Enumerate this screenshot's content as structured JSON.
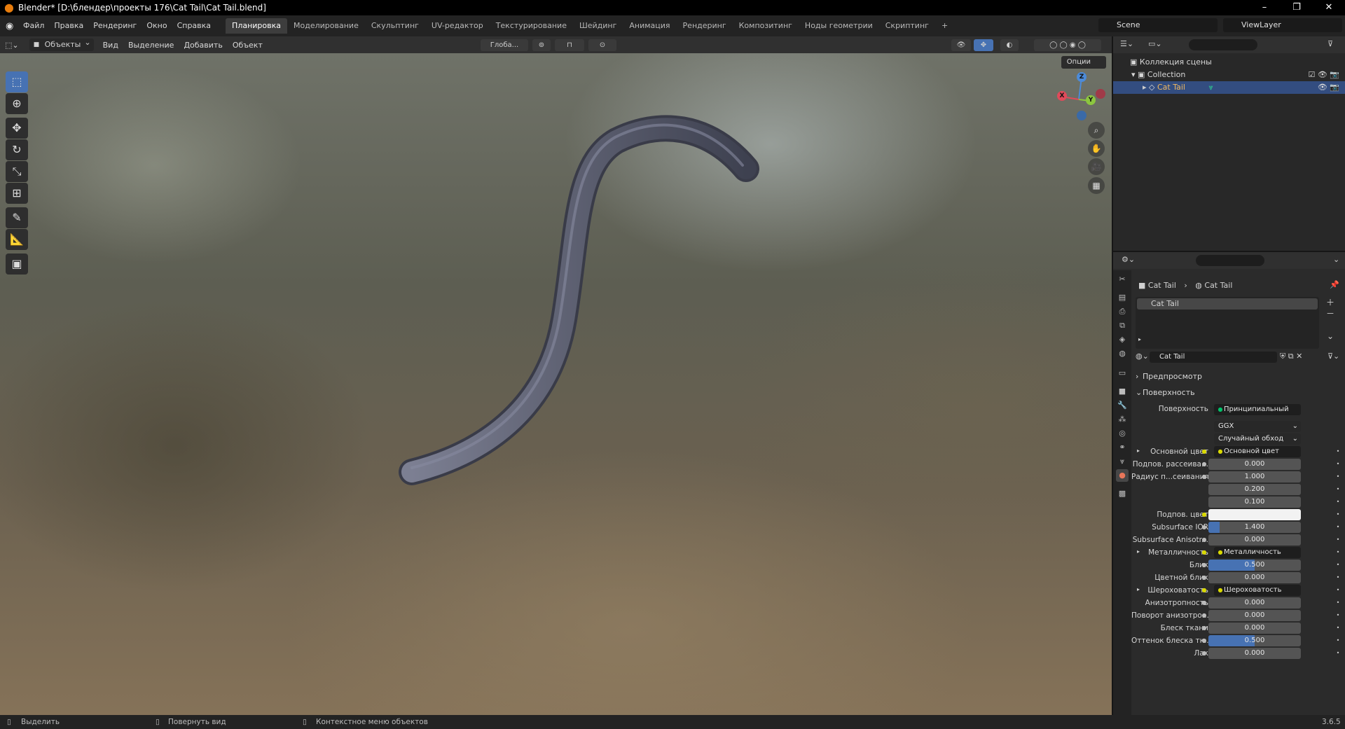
{
  "window": {
    "title": "Blender* [D:\\блендер\\проекты 176\\Cat Tail\\Cat Tail.blend]",
    "controls": [
      "–",
      "❐",
      "✕"
    ]
  },
  "menubar": {
    "items": [
      "Файл",
      "Правка",
      "Рендеринг",
      "Окно",
      "Справка"
    ],
    "workspaces": [
      "Планировка",
      "Моделирование",
      "Скульптинг",
      "UV-редактор",
      "Текстурирование",
      "Шейдинг",
      "Анимация",
      "Рендеринг",
      "Композитинг",
      "Ноды геометрии",
      "Скриптинг",
      "+"
    ],
    "active_workspace": "Планировка",
    "scene": "Scene",
    "view_layer": "ViewLayer"
  },
  "viewport_header": {
    "mode": "Объекты",
    "menus": [
      "Вид",
      "Выделение",
      "Добавить",
      "Объект"
    ],
    "transform_orientation": "Глоба...",
    "options": "Опции"
  },
  "toolbar": {
    "tools": [
      "select-box",
      "cursor",
      "move",
      "rotate",
      "scale",
      "transform",
      "annotate",
      "measure",
      "add-cube"
    ],
    "active": "select-box"
  },
  "gizmo": {
    "x": "X",
    "y": "Y",
    "z": "Z"
  },
  "outliner": {
    "scene_collection": "Коллекция сцены",
    "collection": "Collection",
    "object": "Cat Tail"
  },
  "properties": {
    "breadcrumb_object": "Cat Tail",
    "breadcrumb_material": "Cat Tail",
    "material_slot": "Cat Tail",
    "material_name": "Cat Tail",
    "panel_preview": "Предпросмотр",
    "panel_surface": "Поверхность",
    "surface_label": "Поверхность",
    "surface_value": "Принципиальный BSDF",
    "distribution": "GGX",
    "subsurface_method": "Случайный обход",
    "rows": [
      {
        "label": "Основной цвет",
        "value": "Основной цвет",
        "kind": "link",
        "arrow": true
      },
      {
        "label": "Подпов. рассеива...",
        "value": "0.000",
        "kind": "num",
        "fill": 0
      },
      {
        "label": "Радиус п...сеивания",
        "value": "1.000",
        "kind": "num",
        "fill": 0
      },
      {
        "label": "",
        "value": "0.200",
        "kind": "num",
        "fill": 0
      },
      {
        "label": "",
        "value": "0.100",
        "kind": "num",
        "fill": 0
      },
      {
        "label": "Подпов. цвет",
        "value": "",
        "kind": "color",
        "fill": 0
      },
      {
        "label": "Subsurface IOR",
        "value": "1.400",
        "kind": "num",
        "fill": 0.12
      },
      {
        "label": "Subsurface Anisotr...",
        "value": "0.000",
        "kind": "num",
        "fill": 0
      },
      {
        "label": "Металличность",
        "value": "Металличность",
        "kind": "link",
        "arrow": true
      },
      {
        "label": "Блик",
        "value": "0.500",
        "kind": "num",
        "fill": 0.5
      },
      {
        "label": "Цветной блик",
        "value": "0.000",
        "kind": "num",
        "fill": 0
      },
      {
        "label": "Шероховатость",
        "value": "Шероховатость",
        "kind": "link",
        "arrow": true
      },
      {
        "label": "Анизотропность",
        "value": "0.000",
        "kind": "num",
        "fill": 0
      },
      {
        "label": "Поворот анизотро...",
        "value": "0.000",
        "kind": "num",
        "fill": 0
      },
      {
        "label": "Блеск ткани",
        "value": "0.000",
        "kind": "num",
        "fill": 0
      },
      {
        "label": "Оттенок блеска тк...",
        "value": "0.500",
        "kind": "num",
        "fill": 0.5
      },
      {
        "label": "Лак",
        "value": "0.000",
        "kind": "num",
        "fill": 0
      }
    ]
  },
  "statusbar": {
    "select": "Выделить",
    "rotate_view": "Повернуть вид",
    "context_menu": "Контекстное меню объектов",
    "version": "3.6.5"
  },
  "colors": {
    "accent": "#4772b3",
    "tail": "#5c5f70",
    "selection": "#334d80"
  }
}
